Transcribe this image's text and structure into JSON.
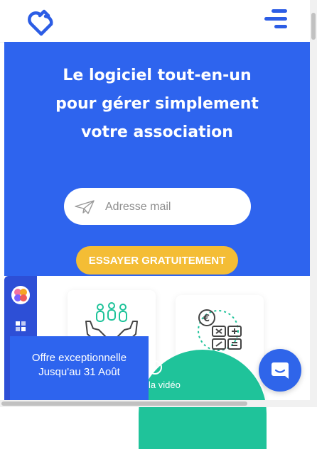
{
  "header": {
    "logo_icon": "heart-drop-logo-icon",
    "menu_icon": "hamburger-menu-icon"
  },
  "hero": {
    "title_lines": [
      "Le logiciel tout-en-un",
      "pour gérer simplement",
      "votre association"
    ],
    "email_placeholder": "Adresse mail",
    "email_icon": "paper-plane-icon",
    "cta_label": "ESSAYER GRATUITEMENT"
  },
  "features": {
    "card_1_icon": "hands-people-icon",
    "card_2_icon": "calculator-coin-icon",
    "video_label": "la vidéo",
    "video_icon": "play-icon"
  },
  "side_widget": {
    "icons": [
      "brain-icon",
      "grid-icon"
    ]
  },
  "offer": {
    "line_1": "Offre exceptionnelle",
    "line_2": "Jusqu'au 31 Août"
  },
  "chat": {
    "icon": "chat-bubble-icon"
  },
  "colors": {
    "brand_blue": "#2e64ee",
    "cta_yellow": "#f4bd35",
    "teal": "#1fc39a",
    "side_blue": "#2d4fd6"
  }
}
